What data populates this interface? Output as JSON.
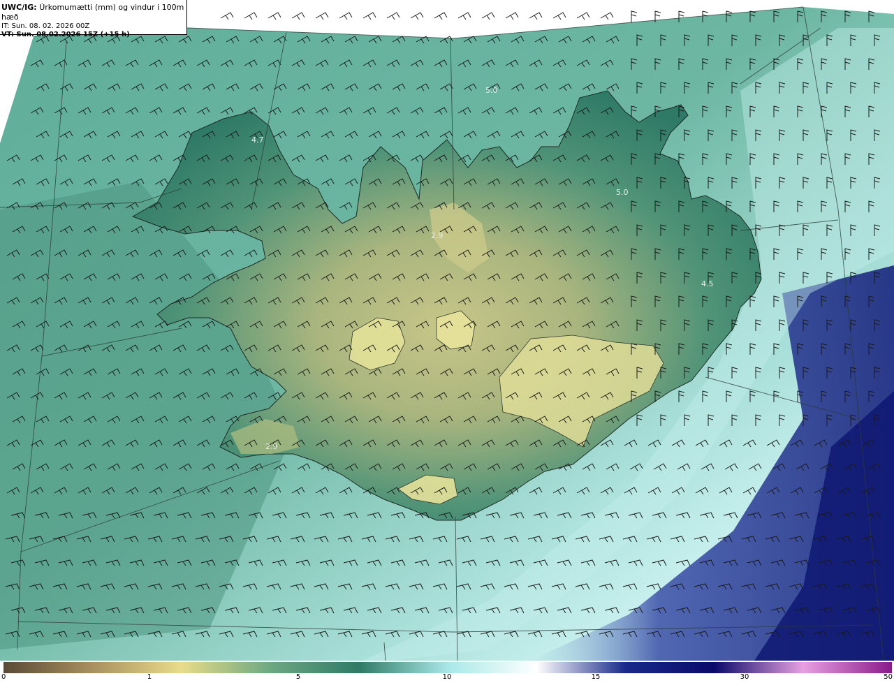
{
  "header": {
    "title_code": "UWC/IG:",
    "title_text": "Úrkomumætti (mm) og vindur i 100m hæð",
    "init_time": "IT: Sun. 08. 02. 2026 00Z",
    "valid_time": "VT: Sun. 08.02.2026 15Z (+15 h)"
  },
  "map_values": [
    {
      "name": "value-label-westfjords",
      "text": "4.7"
    },
    {
      "name": "value-label-north-sea",
      "text": "5.0"
    },
    {
      "name": "value-label-northeast",
      "text": "5.0"
    },
    {
      "name": "value-label-north-central",
      "text": "2.9"
    },
    {
      "name": "value-label-east",
      "text": "4.5"
    },
    {
      "name": "value-label-southwest",
      "text": "2.9"
    }
  ],
  "colorbar": {
    "ticks": [
      "0",
      "1",
      "5",
      "10",
      "15",
      "30",
      "50"
    ],
    "colors": [
      "#5a4a36",
      "#a89060",
      "#e8dc8a",
      "#6da882",
      "#2f7a66",
      "#a8e8e8",
      "#ffffff",
      "#1a2a8a",
      "#0a0a6a",
      "#e8a0e0",
      "#8a1a8a"
    ]
  },
  "colors": {
    "sea_base": "#6fb9a5",
    "land_low": "#3f8a72",
    "land_high": "#c9c98a",
    "sea_light": "#bfe9e6",
    "deep_blue": "#1a1f7a"
  }
}
